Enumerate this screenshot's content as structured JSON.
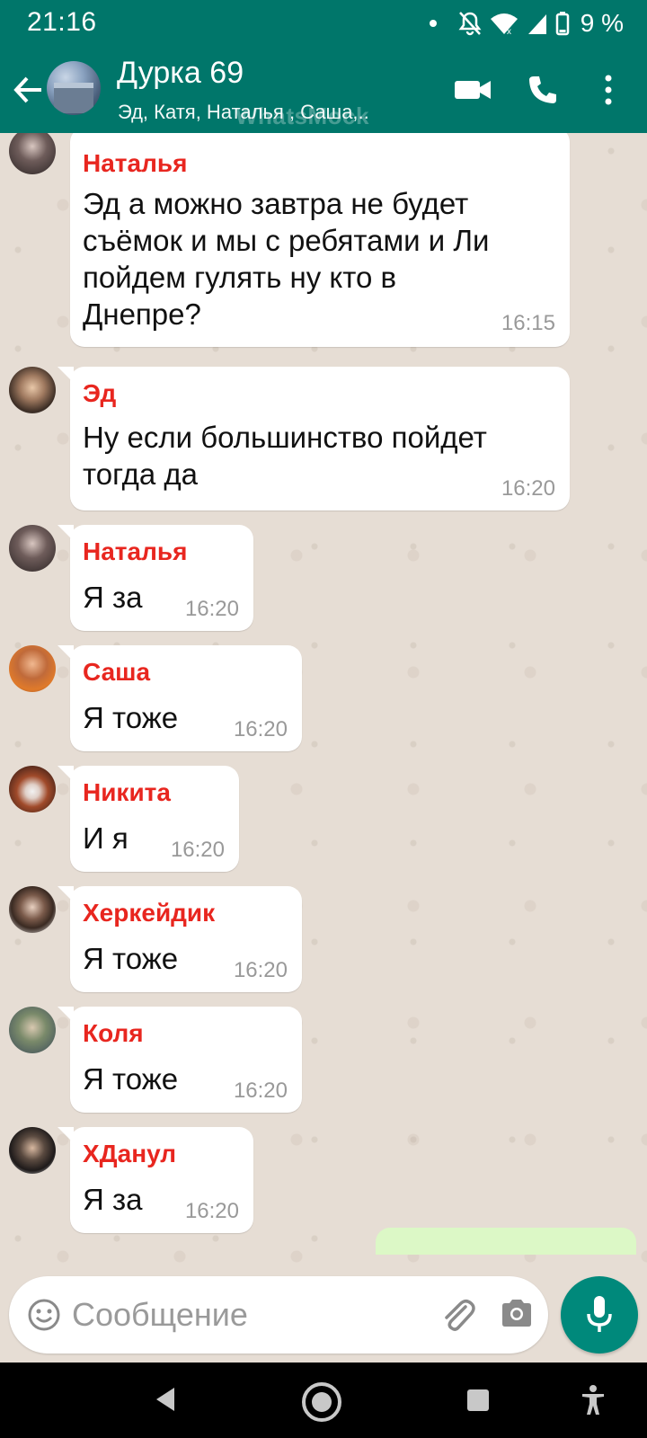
{
  "status": {
    "time": "21:16",
    "battery": "9 %"
  },
  "header": {
    "title": "Дурка 69",
    "subtitle": "Эд, Катя, Наталья , Саша,..",
    "watermark": "WhatsMock"
  },
  "messages": [
    {
      "sender": "Наталья",
      "text": "Эд а можно завтра не будет съёмок и мы с ребятами и Ли пойдем гулять ну кто в Днепре?",
      "time": "16:15"
    },
    {
      "sender": "Эд",
      "text": "Ну если большинство пойдет тогда да",
      "time": "16:20"
    },
    {
      "sender": "Наталья",
      "text": "Я за",
      "time": "16:20"
    },
    {
      "sender": "Саша",
      "text": "Я тоже",
      "time": "16:20"
    },
    {
      "sender": "Никита",
      "text": "И я",
      "time": "16:20"
    },
    {
      "sender": "Херкейдик",
      "text": "Я тоже",
      "time": "16:20"
    },
    {
      "sender": "Коля",
      "text": "Я тоже",
      "time": "16:20"
    },
    {
      "sender": "ХДанул",
      "text": "Я за",
      "time": "16:20"
    }
  ],
  "input": {
    "placeholder": "Сообщение"
  },
  "colors": {
    "header": "#00766a",
    "sender": "#e8261f",
    "mic": "#00897b",
    "chat_bg": "#e6ddd4"
  }
}
